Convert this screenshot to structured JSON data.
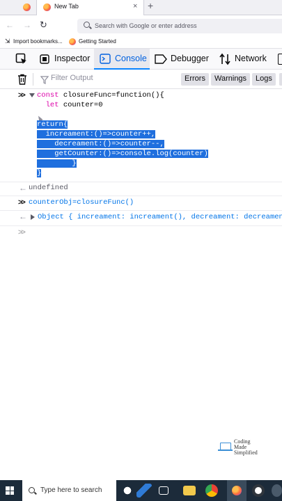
{
  "browser": {
    "tabs": [
      {
        "label": "New Tab",
        "active": true
      }
    ],
    "new_tab_symbol": "+",
    "close_symbol": "×",
    "nav": {
      "back": "←",
      "forward": "→",
      "reload": "↻"
    },
    "url_placeholder": "Search with Google or enter address",
    "bookmarks": [
      {
        "label": "Import bookmarks..."
      },
      {
        "label": "Getting Started"
      }
    ]
  },
  "devtools": {
    "tabs": [
      {
        "label": "Inspector",
        "icon": "pick-element-icon"
      },
      {
        "label": "Console",
        "icon": "console-icon",
        "active": true
      },
      {
        "label": "Debugger",
        "icon": "debugger-icon"
      },
      {
        "label": "Network",
        "icon": "network-icon"
      }
    ],
    "filter_placeholder": "Filter Output",
    "filter_buttons": [
      "Errors",
      "Warnings",
      "Logs"
    ]
  },
  "console": {
    "entry1": {
      "line1_kw": "const",
      "line1_rest": " closureFunc=function(){",
      "line2_kw": "let",
      "line2_rest": " counter=0",
      "sel1_kw": "return",
      "sel1_rest": "{",
      "sel2": "increament:()=>counter++,",
      "sel3": "decreament:()=>counter--,",
      "sel4": "getCounter:()=>console.log(counter)",
      "sel5": "}",
      "sel6": "}"
    },
    "result1": "undefined",
    "entry2": "counterObj=closureFunc()",
    "result2": "Object { increament: increament(), decreament: decreament("
  },
  "watermark": {
    "line1": "Coding",
    "line2": "Made",
    "line3": "Simplified"
  },
  "taskbar": {
    "search_placeholder": "Type here to search"
  },
  "colors": {
    "accent": "#0a84ff",
    "selection": "#1f6fde",
    "keyword": "#dd00a9",
    "function": "#0074e8",
    "taskbar": "#1c2b3a"
  }
}
